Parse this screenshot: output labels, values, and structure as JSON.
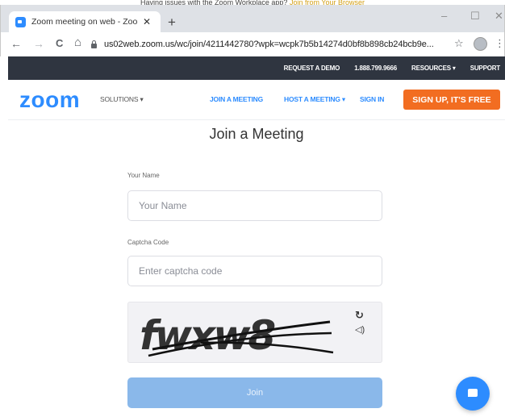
{
  "caption": {
    "text": "Having issues with the Zoom Workplace app? ",
    "link": "Join from Your Browser"
  },
  "browser": {
    "tab_title": "Zoom meeting on web - Zoom",
    "tab_close": "✕",
    "new_tab": "+",
    "minimize": "–",
    "maximize": "☐",
    "close": "✕",
    "back": "←",
    "forward": "→",
    "reload": "C",
    "home": "⌂",
    "url": "us02web.zoom.us/wc/join/4211442780?wpk=wcpk7b5b14274d0bf8b898cb24bcb9e...",
    "star": "☆",
    "menu": "⋮"
  },
  "topbar": {
    "request_demo": "REQUEST A DEMO",
    "phone": "1.888.799.9666",
    "resources": "RESOURCES ▾",
    "support": "SUPPORT"
  },
  "nav": {
    "logo": "zoom",
    "solutions": "SOLUTIONS ▾",
    "join": "JOIN A MEETING",
    "host": "HOST A MEETING ▾",
    "signin": "SIGN IN",
    "signup": "SIGN UP, IT'S FREE"
  },
  "form": {
    "title": "Join a Meeting",
    "name_label": "Your Name",
    "name_placeholder": "Your Name",
    "captcha_label": "Captcha Code",
    "captcha_placeholder": "Enter captcha code",
    "captcha_text": "fwxw8",
    "join_button": "Join"
  },
  "colors": {
    "zoom_blue": "#2d8cff",
    "signup_orange": "#f26d21",
    "topbar": "#2f3540",
    "join_disabled": "#8ab8ea"
  },
  "icons": {
    "refresh": "refresh-icon",
    "audio": "speaker-icon",
    "chat": "chat-bubble-icon"
  }
}
